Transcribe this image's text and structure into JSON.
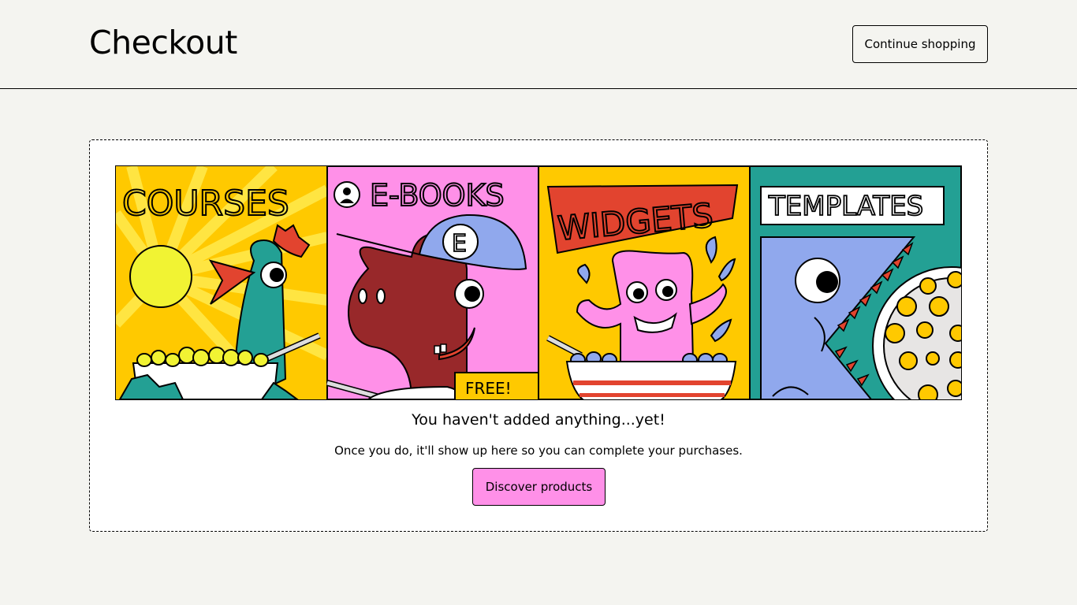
{
  "header": {
    "title": "Checkout",
    "continue_label": "Continue shopping"
  },
  "empty_state": {
    "heading": "You haven't added anything...yet!",
    "subtext": "Once you do, it'll show up here so you can complete your purchases.",
    "cta_label": "Discover products"
  },
  "banner": {
    "panels": [
      {
        "label": "COURSES",
        "bg": "#ffc900"
      },
      {
        "label": "E-BOOKS",
        "bg": "#ff90e8"
      },
      {
        "label": "WIDGETS",
        "bg": "#ffc900"
      },
      {
        "label": "TEMPLATES",
        "bg": "#23a094"
      }
    ],
    "free_tag": "FREE!"
  },
  "colors": {
    "page_bg": "#f4f4f0",
    "accent_pink": "#ff90e8",
    "yellow": "#ffc900",
    "teal": "#23a094",
    "red": "#e2442f",
    "blue": "#90a8ed"
  }
}
